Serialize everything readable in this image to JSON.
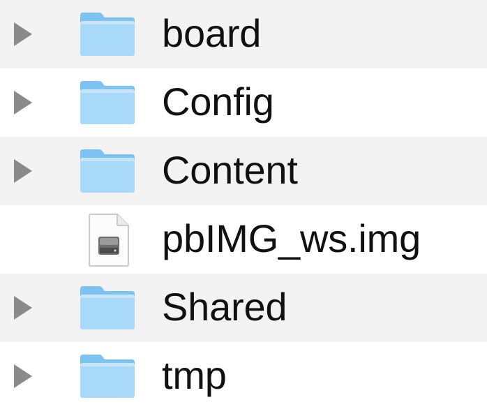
{
  "rows": [
    {
      "type": "folder",
      "name": "board",
      "expandable": true,
      "icon": "folder-icon"
    },
    {
      "type": "folder",
      "name": "Config",
      "expandable": true,
      "icon": "folder-icon"
    },
    {
      "type": "folder",
      "name": "Content",
      "expandable": true,
      "icon": "folder-icon"
    },
    {
      "type": "file",
      "name": "pbIMG_ws.img",
      "expandable": false,
      "icon": "disk-image-icon"
    },
    {
      "type": "folder",
      "name": "Shared",
      "expandable": true,
      "icon": "folder-icon"
    },
    {
      "type": "folder",
      "name": "tmp",
      "expandable": true,
      "icon": "folder-icon"
    }
  ],
  "colors": {
    "row_alt": "#f3f3f3",
    "folder_light": "#a9d9f9",
    "folder_dark": "#7cc3f2",
    "disclosure": "#8a8a8a"
  }
}
